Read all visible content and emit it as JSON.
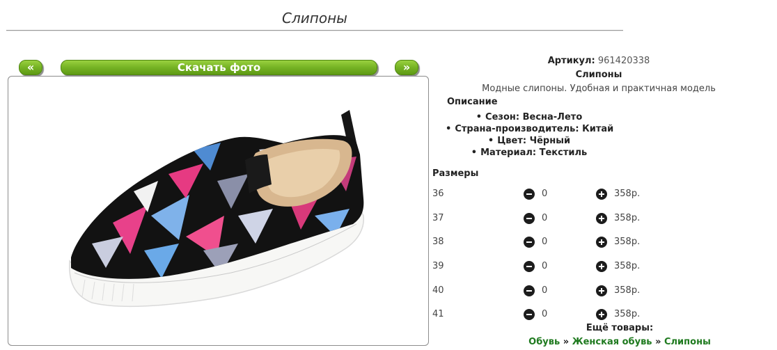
{
  "page": {
    "title": "Слипоны"
  },
  "gallery": {
    "prev_label": "«",
    "next_label": "»",
    "download_label": "Скачать фото"
  },
  "product": {
    "article_label": "Артикул:",
    "article_value": "961420338",
    "name": "Слипоны",
    "short_description": "Модные слипоны. Удобная и практичная модель",
    "description_heading": "Описание",
    "features": [
      "Сезон: Весна-Лето",
      "Страна-производитель: Китай",
      "Цвет: Чёрный",
      "Материал: Текстиль"
    ],
    "sizes_heading": "Размеры",
    "sizes": [
      {
        "size": "36",
        "qty": "0",
        "price": "358р."
      },
      {
        "size": "37",
        "qty": "0",
        "price": "358р."
      },
      {
        "size": "38",
        "qty": "0",
        "price": "358р."
      },
      {
        "size": "39",
        "qty": "0",
        "price": "358р."
      },
      {
        "size": "40",
        "qty": "0",
        "price": "358р."
      },
      {
        "size": "41",
        "qty": "0",
        "price": "358р."
      }
    ]
  },
  "more": {
    "heading": "Ещё товары:",
    "crumbs": [
      "Обувь",
      "Женская обувь",
      "Слипоны"
    ],
    "separator": "»"
  },
  "colors": {
    "button_green": "#78b526",
    "link_green": "#1f7a1f"
  }
}
